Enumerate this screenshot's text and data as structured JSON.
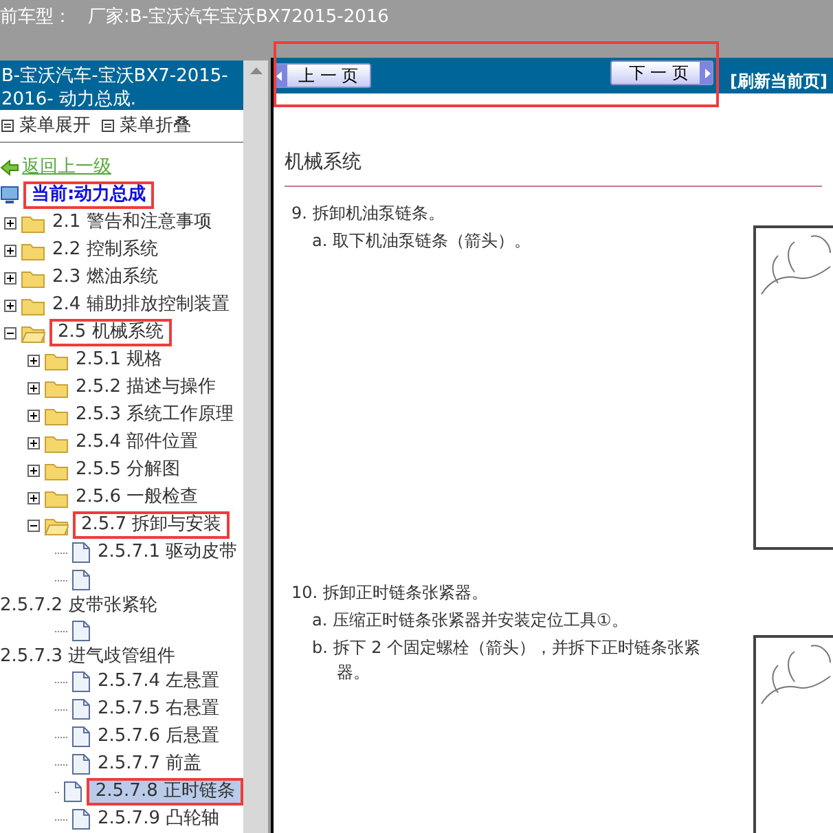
{
  "header": {
    "label": "前车型：",
    "value": "厂家:B-宝沃汽车宝沃BX72015-2016"
  },
  "sidebar": {
    "title": "B-宝沃汽车-宝沃BX7-2015-2016- 动力总成.",
    "menu": [
      {
        "label": "菜单展开"
      },
      {
        "label": "菜单折叠"
      }
    ],
    "back": "返回上一级",
    "current": {
      "label": "当前:动力总成",
      "highlighted": true
    },
    "tree": [
      {
        "kind": "folder",
        "label": "2.1 警告和注意事项",
        "expanded": false,
        "highlighted": false,
        "selected": false
      },
      {
        "kind": "folder",
        "label": "2.2 控制系统",
        "expanded": false,
        "highlighted": false,
        "selected": false
      },
      {
        "kind": "folder",
        "label": "2.3 燃油系统",
        "expanded": false,
        "highlighted": false,
        "selected": false
      },
      {
        "kind": "folder",
        "label": "2.4 辅助排放控制装置",
        "expanded": false,
        "highlighted": false,
        "selected": false
      },
      {
        "kind": "folder",
        "label": "2.5 机械系统",
        "expanded": true,
        "highlighted": true,
        "selected": false,
        "children": [
          {
            "kind": "folder",
            "label": "2.5.1 规格",
            "expanded": false,
            "highlighted": false,
            "selected": false
          },
          {
            "kind": "folder",
            "label": "2.5.2 描述与操作",
            "expanded": false,
            "highlighted": false,
            "selected": false
          },
          {
            "kind": "folder",
            "label": "2.5.3 系统工作原理",
            "expanded": false,
            "highlighted": false,
            "selected": false
          },
          {
            "kind": "folder",
            "label": "2.5.4 部件位置",
            "expanded": false,
            "highlighted": false,
            "selected": false
          },
          {
            "kind": "folder",
            "label": "2.5.5 分解图",
            "expanded": false,
            "highlighted": false,
            "selected": false
          },
          {
            "kind": "folder",
            "label": "2.5.6 一般检查",
            "expanded": false,
            "highlighted": false,
            "selected": false
          },
          {
            "kind": "folder",
            "label": "2.5.7 拆卸与安装",
            "expanded": true,
            "highlighted": true,
            "selected": false,
            "children": [
              {
                "kind": "doc",
                "label": "2.5.7.1 驱动皮带",
                "highlighted": false,
                "selected": false
              },
              {
                "kind": "doc_wrapped",
                "label": "2.5.7.2 皮带张紧轮",
                "highlighted": false,
                "selected": false
              },
              {
                "kind": "doc_wrapped",
                "label": "2.5.7.3 进气歧管组件",
                "highlighted": false,
                "selected": false
              },
              {
                "kind": "doc",
                "label": "2.5.7.4 左悬置",
                "highlighted": false,
                "selected": false
              },
              {
                "kind": "doc",
                "label": "2.5.7.5 右悬置",
                "highlighted": false,
                "selected": false
              },
              {
                "kind": "doc",
                "label": "2.5.7.6 后悬置",
                "highlighted": false,
                "selected": false
              },
              {
                "kind": "doc",
                "label": "2.5.7.7 前盖",
                "highlighted": false,
                "selected": false
              },
              {
                "kind": "doc",
                "label": "2.5.7.8 正时链条",
                "highlighted": true,
                "selected": true
              },
              {
                "kind": "doc",
                "label": "2.5.7.9 凸轮轴",
                "highlighted": false,
                "selected": false
              }
            ]
          }
        ]
      }
    ]
  },
  "nav": {
    "highlighted": true,
    "prev": "上 一 页",
    "next": "下 一 页",
    "refresh": "[刷新当前页]"
  },
  "document": {
    "heading": "机械系统",
    "steps": [
      {
        "number": "9.",
        "text": "拆卸机油泵链条。",
        "substeps": [
          {
            "label": "a.",
            "text": "取下机油泵链条（箭头）。"
          }
        ]
      },
      {
        "number": "10.",
        "text": "拆卸正时链条张紧器。",
        "substeps": [
          {
            "label": "a.",
            "text": "压缩正时链条张紧器并安装定位工具①。"
          },
          {
            "label": "b.",
            "text": "拆下 2 个固定螺栓（箭头），并拆下正时链条张紧器。"
          }
        ]
      }
    ]
  }
}
